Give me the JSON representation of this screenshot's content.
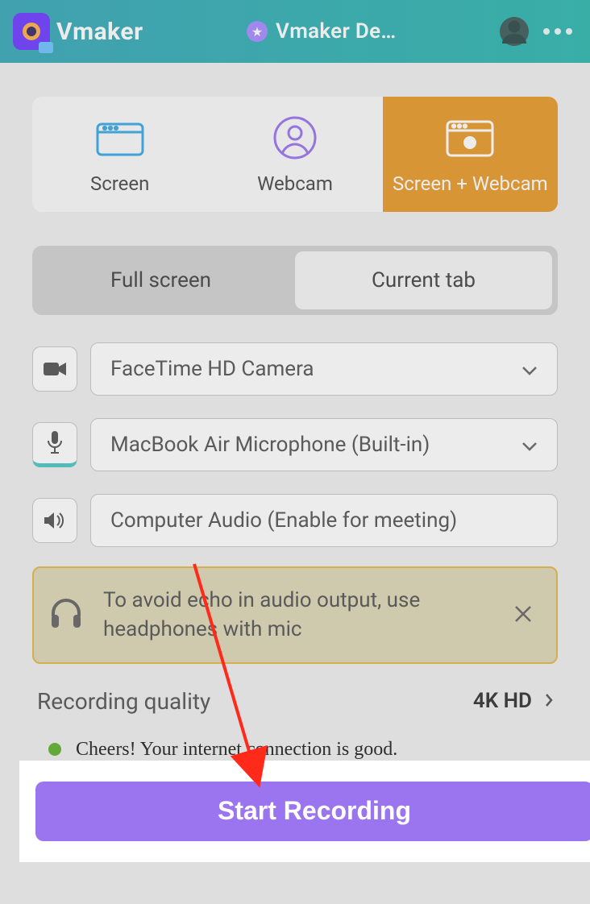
{
  "header": {
    "brand": "Vmaker",
    "team_name": "Vmaker De…"
  },
  "modes": {
    "screen": "Screen",
    "webcam": "Webcam",
    "combo": "Screen + Webcam",
    "selected": "combo"
  },
  "scope": {
    "full": "Full screen",
    "tab": "Current tab",
    "selected": "tab"
  },
  "devices": {
    "camera": "FaceTime HD Camera",
    "mic": "MacBook Air Microphone (Built-in)",
    "audio": "Computer Audio (Enable for meeting)"
  },
  "hint": {
    "text": "To avoid echo in audio output, use headphones with mic"
  },
  "quality": {
    "label": "Recording quality",
    "value": "4K HD"
  },
  "status": {
    "color": "green",
    "text": "Cheers! Your internet connection is good."
  },
  "footer": {
    "start_label": "Start Recording"
  }
}
